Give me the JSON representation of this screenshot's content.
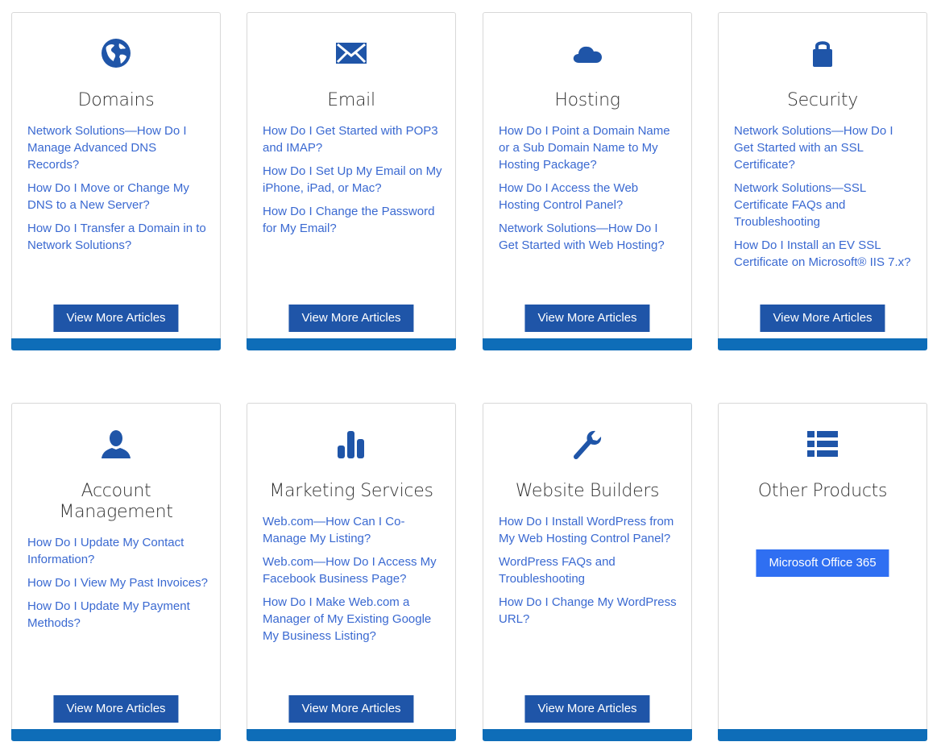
{
  "colors": {
    "accent": "#1f55a8",
    "bar": "#0e6db8",
    "link": "#3a69d1",
    "bright_button": "#2f6ff2"
  },
  "cards": [
    {
      "title": "Domains",
      "icon": "globe-icon",
      "links": [
        "Network Solutions—How Do I Manage Advanced DNS Records?",
        "How Do I Move or Change My DNS to a New Server?",
        "How Do I Transfer a Domain in to Network Solutions?"
      ],
      "button": "View More Articles"
    },
    {
      "title": "Email",
      "icon": "envelope-icon",
      "links": [
        "How Do I Get Started with POP3 and IMAP?",
        "How Do I Set Up My Email on My iPhone, iPad, or Mac?",
        "How Do I Change the Password for My Email?"
      ],
      "button": "View More Articles"
    },
    {
      "title": "Hosting",
      "icon": "cloud-icon",
      "links": [
        "How Do I Point a Domain Name or a Sub Domain Name to My Hosting Package?",
        "How Do I Access the Web Hosting Control Panel?",
        "Network Solutions—How Do I Get Started with Web Hosting?"
      ],
      "button": "View More Articles"
    },
    {
      "title": "Security",
      "icon": "lock-icon",
      "links": [
        "Network Solutions—How Do I Get Started with an SSL Certificate?",
        "Network Solutions—SSL Certificate FAQs and Troubleshooting",
        "How Do I Install an EV SSL Certificate on Microsoft® IIS 7.x?"
      ],
      "button": "View More Articles"
    },
    {
      "title": "Account Management",
      "icon": "user-icon",
      "links": [
        "How Do I Update My Contact Information?",
        "How Do I View My Past Invoices?",
        "How Do I Update My Payment Methods?"
      ],
      "button": "View More Articles"
    },
    {
      "title": "Marketing Services",
      "icon": "bar-chart-icon",
      "links": [
        "Web.com—How Can I Co-Manage My Listing?",
        "Web.com—How Do I Access My Facebook Business Page?",
        "How Do I Make Web.com a Manager of My Existing Google My Business Listing?"
      ],
      "button": "View More Articles"
    },
    {
      "title": "Website Builders",
      "icon": "wrench-icon",
      "links": [
        "How Do I Install WordPress from My Web Hosting Control Panel?",
        "WordPress FAQs and Troubleshooting",
        "How Do I Change My WordPress URL?"
      ],
      "button": "View More Articles"
    },
    {
      "title": "Other Products",
      "icon": "list-icon",
      "links": [],
      "button": "Microsoft Office 365"
    }
  ]
}
